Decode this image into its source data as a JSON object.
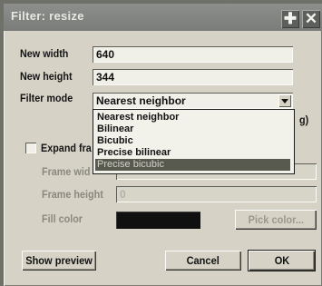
{
  "window": {
    "title": "Filter: resize",
    "move_glyph": "✚",
    "close_glyph": "✕"
  },
  "fields": {
    "new_width_label": "New width",
    "new_width_value": "640",
    "new_height_label": "New height",
    "new_height_value": "344",
    "filter_mode_label": "Filter mode",
    "filter_mode_value": "Nearest neighbor"
  },
  "filter_mode_options": [
    "Nearest neighbor",
    "Bilinear",
    "Bicubic",
    "Precise bilinear",
    "Precise bicubic"
  ],
  "partial_text": {
    "behind_dropdown_right": "g)",
    "expand_frame_label": "Expand fra",
    "frame_width_label": "Frame wid"
  },
  "frame": {
    "frame_height_label": "Frame height",
    "frame_height_value": "0",
    "fill_color_label": "Fill color",
    "fill_color_value": "#101010",
    "pick_color_label": "Pick color..."
  },
  "buttons": {
    "show_preview": "Show preview",
    "cancel": "Cancel",
    "ok": "OK"
  }
}
